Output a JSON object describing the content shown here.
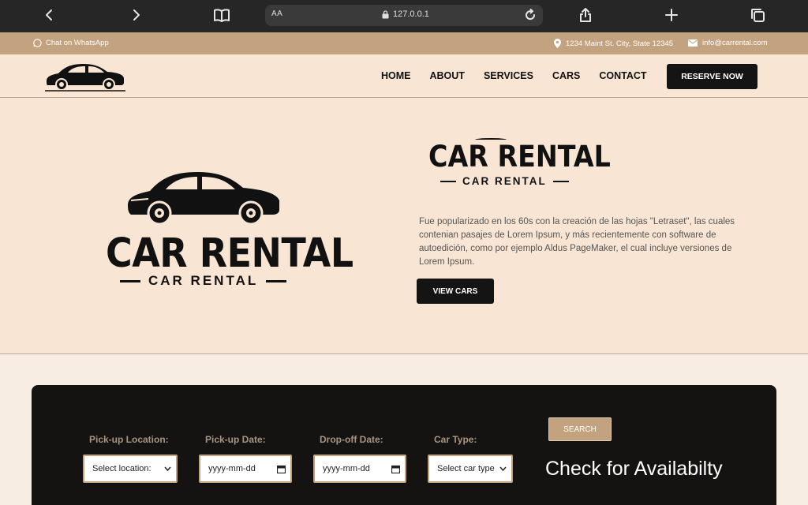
{
  "browser": {
    "text_size_label": "AA",
    "url": "127.0.0.1"
  },
  "topbar": {
    "whatsapp": "Chat on WhatsApp",
    "address": "1234 Maint St. City, State 12345",
    "email": "info@carrental.com"
  },
  "nav": {
    "links": [
      "HOME",
      "ABOUT",
      "SERVICES",
      "CARS",
      "CONTACT"
    ],
    "reserve_label": "RESERVE NOW"
  },
  "hero": {
    "logo_title": "CAR RENTAL",
    "logo_subtitle": "CAR RENTAL",
    "heading_title": "CAR RENTAL",
    "heading_subtitle": "CAR RENTAL",
    "description": "Fue popularizado en los 60s con la creación de las hojas \"Letraset\", las cuales contenian pasajes de Lorem Ipsum, y más recientemente con software de autoedición, como por ejemplo Aldus PageMaker, el cual incluye versiones de Lorem Ipsum.",
    "cta_label": "VIEW CARS"
  },
  "booking": {
    "pickup_location_label": "Pick-up Location:",
    "pickup_location_value": "Select location:",
    "pickup_date_label": "Pick-up Date:",
    "pickup_date_placeholder": "yyyy-mm-dd",
    "dropoff_date_label": "Drop-off Date:",
    "dropoff_date_placeholder": "yyyy-mm-dd",
    "car_type_label": "Car Type:",
    "car_type_value": "Select car type",
    "search_label": "SEARCH",
    "availability_text": "Check for Availabilty"
  },
  "colors": {
    "accent": "#c3a37f",
    "hero_bg": "#f9e5d3",
    "dark": "#141414"
  }
}
